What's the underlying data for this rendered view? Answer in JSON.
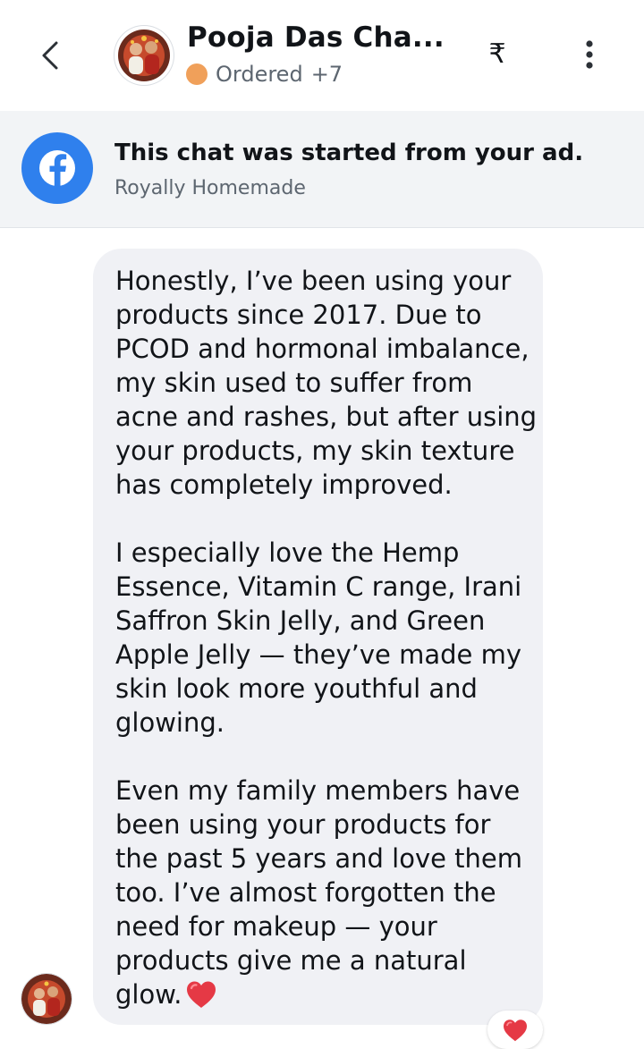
{
  "header": {
    "contact_name": "Pooja Das Cha...",
    "status_label": "Ordered",
    "status_extra": "+7",
    "status_color": "#f0a05a",
    "payment_symbol": "₹",
    "icons": [
      "back-chevron-icon",
      "rupee-icon",
      "more-vertical-icon"
    ]
  },
  "ad_banner": {
    "title": "This chat was started from your ad.",
    "page_name": "Royally Homemade",
    "brand_color": "#2f80ed",
    "icon": "facebook-icon"
  },
  "message": {
    "paragraphs": [
      "Honestly, I’ve been using your\nproducts since 2017. Due to\nPCOD and hormonal imbalance,\nmy skin used to suffer from\nacne and rashes, but after using\nyour products, my skin texture\nhas completely improved.",
      "I especially love the Hemp\nEssence, Vitamin C range, Irani\nSaffron Skin Jelly, and Green\nApple Jelly — they’ve made my\nskin look more youthful and\nglowing.",
      "Even my family members have\nbeen using your products for\nthe past 5 years and love them\ntoo. I’ve almost forgotten the\nneed for makeup — your\nproducts give me a natural\nglow."
    ],
    "inline_emoji": "heart-icon",
    "reaction": "heart-icon",
    "bubble_color": "#f0f1f5",
    "heart_color": "#e53945"
  }
}
